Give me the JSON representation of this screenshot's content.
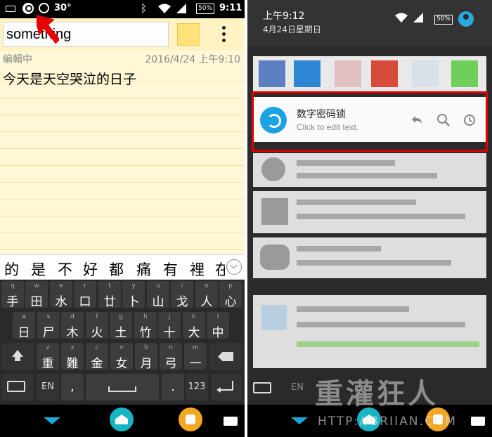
{
  "left": {
    "status": {
      "temperature": "30°",
      "battery": "50%",
      "time": "9:11"
    },
    "note": {
      "title": "something",
      "state": "編輯中",
      "date": "2016/4/24 上午9:10",
      "body": "今天是天空哭泣的日子"
    },
    "candidates": [
      "的",
      "是",
      "不",
      "好",
      "都",
      "痛",
      "有",
      "裡",
      "在"
    ],
    "keyboard": {
      "row1": [
        {
          "hint": "q",
          "glyph": "手"
        },
        {
          "hint": "w",
          "glyph": "田"
        },
        {
          "hint": "e",
          "glyph": "水"
        },
        {
          "hint": "r",
          "glyph": "口"
        },
        {
          "hint": "t",
          "glyph": "廿"
        },
        {
          "hint": "y",
          "glyph": "卜"
        },
        {
          "hint": "u",
          "glyph": "山"
        },
        {
          "hint": "i",
          "glyph": "戈"
        },
        {
          "hint": "o",
          "glyph": "人"
        },
        {
          "hint": "p",
          "glyph": "心"
        }
      ],
      "row2": [
        {
          "hint": "a",
          "glyph": "日"
        },
        {
          "hint": "s",
          "glyph": "尸"
        },
        {
          "hint": "d",
          "glyph": "木"
        },
        {
          "hint": "f",
          "glyph": "火"
        },
        {
          "hint": "g",
          "glyph": "土"
        },
        {
          "hint": "h",
          "glyph": "竹"
        },
        {
          "hint": "j",
          "glyph": "十"
        },
        {
          "hint": "k",
          "glyph": "大"
        },
        {
          "hint": "l",
          "glyph": "中"
        }
      ],
      "row3": [
        {
          "hint": "z",
          "glyph": "重"
        },
        {
          "hint": "x",
          "glyph": "難"
        },
        {
          "hint": "c",
          "glyph": "金"
        },
        {
          "hint": "v",
          "glyph": "女"
        },
        {
          "hint": "b",
          "glyph": "月"
        },
        {
          "hint": "n",
          "glyph": "弓"
        },
        {
          "hint": "m",
          "glyph": "一"
        }
      ],
      "lang": "EN",
      "comma": ",",
      "period": ".",
      "numbers": "123"
    },
    "icons": [
      "keyboard-icon",
      "search-icon",
      "alarm-icon",
      "bluetooth-icon",
      "wifi-icon",
      "signal-icon",
      "battery-icon"
    ]
  },
  "right": {
    "status": {
      "time": "上午9:12",
      "date": "4月24日星期日",
      "battery": "50%"
    },
    "notification": {
      "title": "数字密码锁",
      "subtitle": "Click to edit text."
    },
    "keyboard_lang": "EN",
    "watermark": "重灌狂人",
    "watermark_url": "HTTP://BRIIAN.COM",
    "highlight_color": "#e10000",
    "accent_color": "#1aa1e6"
  }
}
